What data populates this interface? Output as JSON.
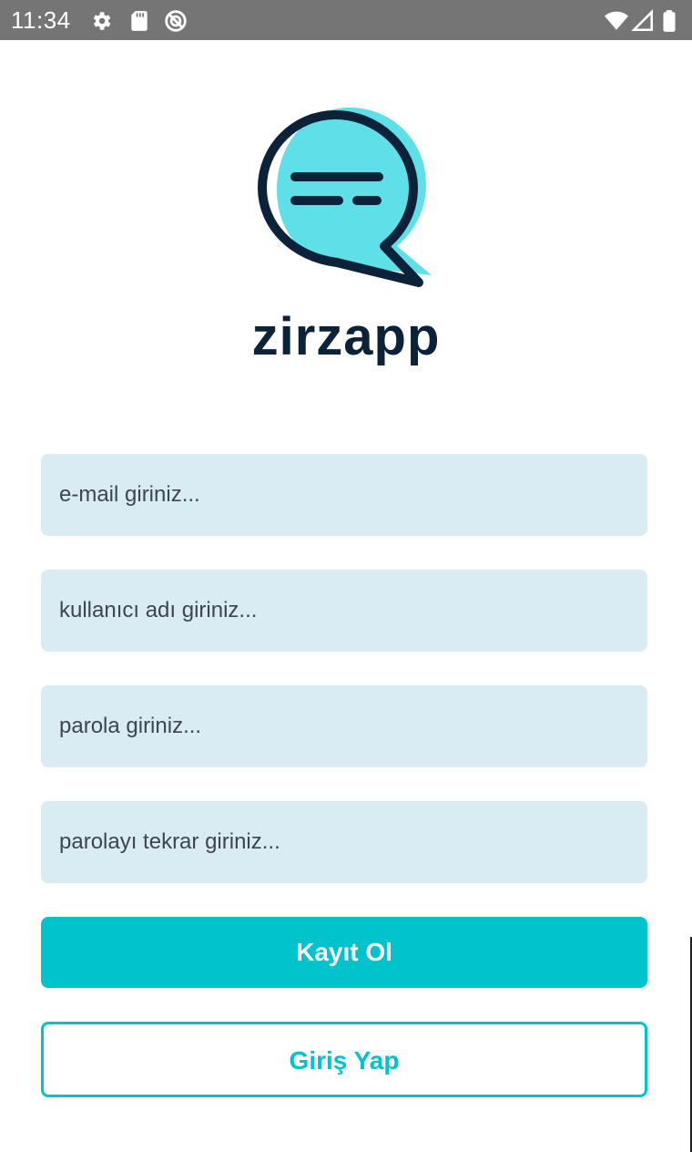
{
  "status_bar": {
    "time": "11:34",
    "icons": [
      "gear-icon",
      "sd-card-icon",
      "do-not-disturb-icon",
      "wifi-icon",
      "cellular-signal-icon",
      "battery-icon"
    ]
  },
  "brand": {
    "name": "zirzapp",
    "logo_icon": "chat-bubble-logo-icon",
    "colors": {
      "dark": "#0b2238",
      "accent": "#5fe0e8"
    }
  },
  "form": {
    "email_placeholder": "e-mail giriniz...",
    "username_placeholder": "kullanıcı adı giriniz...",
    "password_placeholder": "parola giriniz...",
    "password_repeat_placeholder": "parolayı tekrar giriniz...",
    "field_bg_color": "#d9ecf4"
  },
  "buttons": {
    "register_label": "Kayıt Ol",
    "login_label": "Giriş Yap",
    "accent_color": "#00c3cc"
  }
}
